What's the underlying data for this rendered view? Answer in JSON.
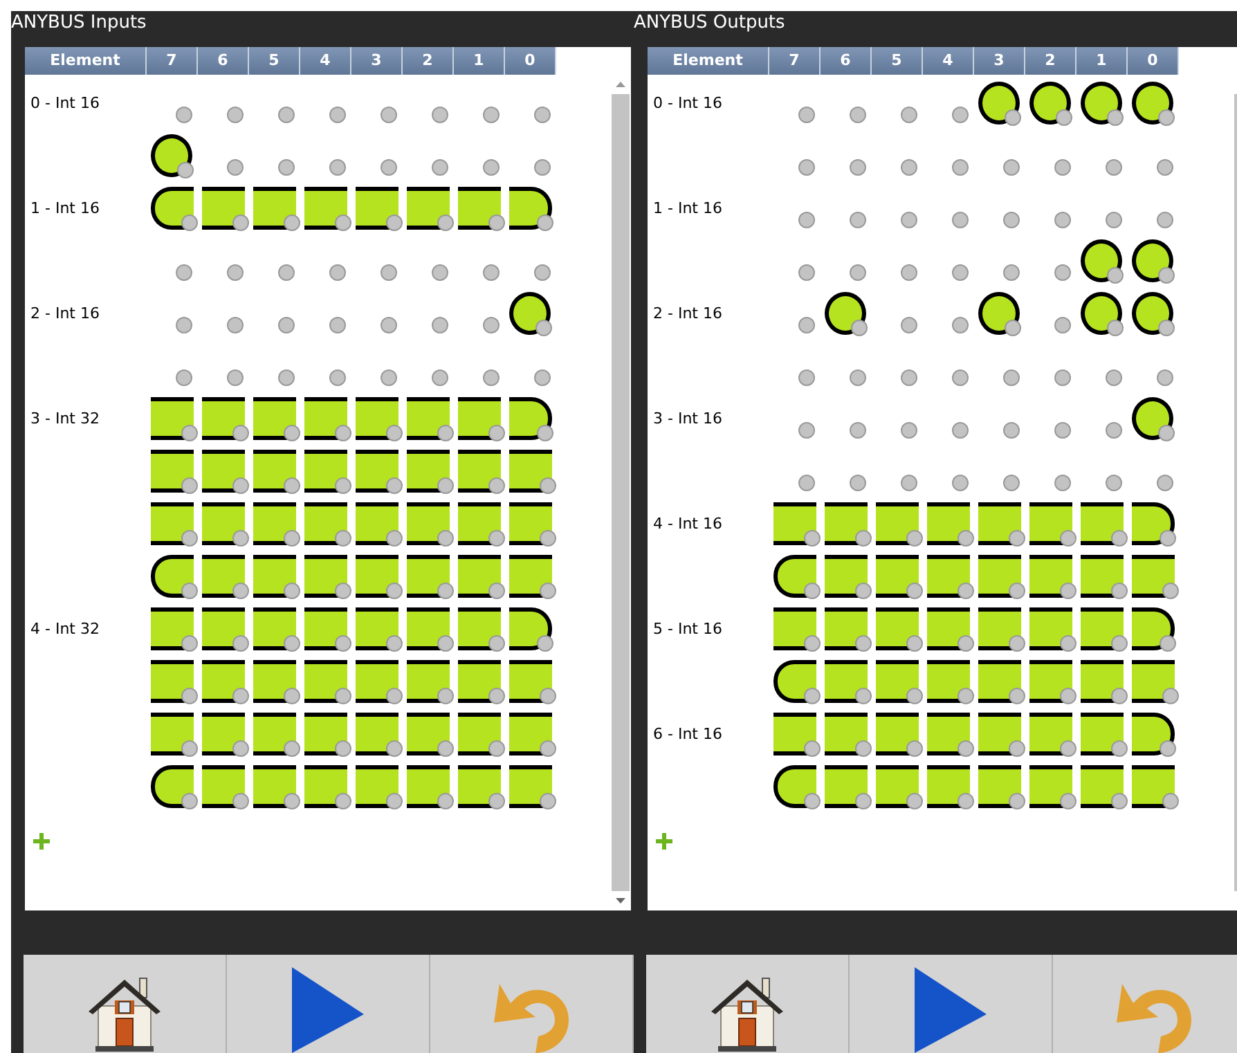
{
  "panels": [
    {
      "title": "ANYBUS Inputs",
      "columns": [
        "Element",
        "7",
        "6",
        "5",
        "4",
        "3",
        "2",
        "1",
        "0"
      ],
      "elements": [
        {
          "label": "0 - Int 16",
          "bytes": [
            [
              {
                "on": false
              },
              {
                "on": false
              },
              {
                "on": false
              },
              {
                "on": false
              },
              {
                "on": false
              },
              {
                "on": false
              },
              {
                "on": false
              },
              {
                "on": false
              }
            ],
            [
              {
                "on": true,
                "round_left": true,
                "round_right": true
              },
              {
                "on": false
              },
              {
                "on": false
              },
              {
                "on": false
              },
              {
                "on": false
              },
              {
                "on": false
              },
              {
                "on": false
              },
              {
                "on": false
              }
            ]
          ]
        },
        {
          "label": "1 - Int 16",
          "bytes": [
            [
              {
                "on": true,
                "round_left": true,
                "round_right": false
              },
              {
                "on": true,
                "round_left": false,
                "round_right": false
              },
              {
                "on": true,
                "round_left": false,
                "round_right": false
              },
              {
                "on": true,
                "round_left": false,
                "round_right": false
              },
              {
                "on": true,
                "round_left": false,
                "round_right": false
              },
              {
                "on": true,
                "round_left": false,
                "round_right": false
              },
              {
                "on": true,
                "round_left": false,
                "round_right": false
              },
              {
                "on": true,
                "round_left": false,
                "round_right": true
              }
            ],
            [
              {
                "on": false
              },
              {
                "on": false
              },
              {
                "on": false
              },
              {
                "on": false
              },
              {
                "on": false
              },
              {
                "on": false
              },
              {
                "on": false
              },
              {
                "on": false
              }
            ]
          ]
        },
        {
          "label": "2 - Int 16",
          "bytes": [
            [
              {
                "on": false
              },
              {
                "on": false
              },
              {
                "on": false
              },
              {
                "on": false
              },
              {
                "on": false
              },
              {
                "on": false
              },
              {
                "on": false
              },
              {
                "on": true,
                "round_left": true,
                "round_right": true
              }
            ],
            [
              {
                "on": false
              },
              {
                "on": false
              },
              {
                "on": false
              },
              {
                "on": false
              },
              {
                "on": false
              },
              {
                "on": false
              },
              {
                "on": false
              },
              {
                "on": false
              }
            ]
          ]
        },
        {
          "label": "3 - Int 32",
          "bytes": [
            [
              {
                "on": true,
                "round_left": false,
                "round_right": false
              },
              {
                "on": true,
                "round_left": false,
                "round_right": false
              },
              {
                "on": true,
                "round_left": false,
                "round_right": false
              },
              {
                "on": true,
                "round_left": false,
                "round_right": false
              },
              {
                "on": true,
                "round_left": false,
                "round_right": false
              },
              {
                "on": true,
                "round_left": false,
                "round_right": false
              },
              {
                "on": true,
                "round_left": false,
                "round_right": false
              },
              {
                "on": true,
                "round_left": false,
                "round_right": true
              }
            ],
            [
              {
                "on": true,
                "round_left": false,
                "round_right": false
              },
              {
                "on": true,
                "round_left": false,
                "round_right": false
              },
              {
                "on": true,
                "round_left": false,
                "round_right": false
              },
              {
                "on": true,
                "round_left": false,
                "round_right": false
              },
              {
                "on": true,
                "round_left": false,
                "round_right": false
              },
              {
                "on": true,
                "round_left": false,
                "round_right": false
              },
              {
                "on": true,
                "round_left": false,
                "round_right": false
              },
              {
                "on": true,
                "round_left": false,
                "round_right": false
              }
            ],
            [
              {
                "on": true,
                "round_left": false,
                "round_right": false
              },
              {
                "on": true,
                "round_left": false,
                "round_right": false
              },
              {
                "on": true,
                "round_left": false,
                "round_right": false
              },
              {
                "on": true,
                "round_left": false,
                "round_right": false
              },
              {
                "on": true,
                "round_left": false,
                "round_right": false
              },
              {
                "on": true,
                "round_left": false,
                "round_right": false
              },
              {
                "on": true,
                "round_left": false,
                "round_right": false
              },
              {
                "on": true,
                "round_left": false,
                "round_right": false
              }
            ],
            [
              {
                "on": true,
                "round_left": true,
                "round_right": false
              },
              {
                "on": true,
                "round_left": false,
                "round_right": false
              },
              {
                "on": true,
                "round_left": false,
                "round_right": false
              },
              {
                "on": true,
                "round_left": false,
                "round_right": false
              },
              {
                "on": true,
                "round_left": false,
                "round_right": false
              },
              {
                "on": true,
                "round_left": false,
                "round_right": false
              },
              {
                "on": true,
                "round_left": false,
                "round_right": false
              },
              {
                "on": true,
                "round_left": false,
                "round_right": false
              }
            ]
          ]
        },
        {
          "label": "4 - Int 32",
          "bytes": [
            [
              {
                "on": true,
                "round_left": false,
                "round_right": false
              },
              {
                "on": true,
                "round_left": false,
                "round_right": false
              },
              {
                "on": true,
                "round_left": false,
                "round_right": false
              },
              {
                "on": true,
                "round_left": false,
                "round_right": false
              },
              {
                "on": true,
                "round_left": false,
                "round_right": false
              },
              {
                "on": true,
                "round_left": false,
                "round_right": false
              },
              {
                "on": true,
                "round_left": false,
                "round_right": false
              },
              {
                "on": true,
                "round_left": false,
                "round_right": true
              }
            ],
            [
              {
                "on": true,
                "round_left": false,
                "round_right": false
              },
              {
                "on": true,
                "round_left": false,
                "round_right": false
              },
              {
                "on": true,
                "round_left": false,
                "round_right": false
              },
              {
                "on": true,
                "round_left": false,
                "round_right": false
              },
              {
                "on": true,
                "round_left": false,
                "round_right": false
              },
              {
                "on": true,
                "round_left": false,
                "round_right": false
              },
              {
                "on": true,
                "round_left": false,
                "round_right": false
              },
              {
                "on": true,
                "round_left": false,
                "round_right": false
              }
            ],
            [
              {
                "on": true,
                "round_left": false,
                "round_right": false
              },
              {
                "on": true,
                "round_left": false,
                "round_right": false
              },
              {
                "on": true,
                "round_left": false,
                "round_right": false
              },
              {
                "on": true,
                "round_left": false,
                "round_right": false
              },
              {
                "on": true,
                "round_left": false,
                "round_right": false
              },
              {
                "on": true,
                "round_left": false,
                "round_right": false
              },
              {
                "on": true,
                "round_left": false,
                "round_right": false
              },
              {
                "on": true,
                "round_left": false,
                "round_right": false
              }
            ],
            [
              {
                "on": true,
                "round_left": true,
                "round_right": false
              },
              {
                "on": true,
                "round_left": false,
                "round_right": false
              },
              {
                "on": true,
                "round_left": false,
                "round_right": false
              },
              {
                "on": true,
                "round_left": false,
                "round_right": false
              },
              {
                "on": true,
                "round_left": false,
                "round_right": false
              },
              {
                "on": true,
                "round_left": false,
                "round_right": false
              },
              {
                "on": true,
                "round_left": false,
                "round_right": false
              },
              {
                "on": true,
                "round_left": false,
                "round_right": false
              }
            ]
          ]
        }
      ]
    },
    {
      "title": "ANYBUS Outputs",
      "columns": [
        "Element",
        "7",
        "6",
        "5",
        "4",
        "3",
        "2",
        "1",
        "0"
      ],
      "elements": [
        {
          "label": "0 - Int 16",
          "bytes": [
            [
              {
                "on": false
              },
              {
                "on": false
              },
              {
                "on": false
              },
              {
                "on": false
              },
              {
                "on": true,
                "round_left": true,
                "round_right": true
              },
              {
                "on": true,
                "round_left": true,
                "round_right": true
              },
              {
                "on": true,
                "round_left": true,
                "round_right": true
              },
              {
                "on": true,
                "round_left": true,
                "round_right": true
              }
            ],
            [
              {
                "on": false
              },
              {
                "on": false
              },
              {
                "on": false
              },
              {
                "on": false
              },
              {
                "on": false
              },
              {
                "on": false
              },
              {
                "on": false
              },
              {
                "on": false
              }
            ]
          ]
        },
        {
          "label": "1 - Int 16",
          "bytes": [
            [
              {
                "on": false
              },
              {
                "on": false
              },
              {
                "on": false
              },
              {
                "on": false
              },
              {
                "on": false
              },
              {
                "on": false
              },
              {
                "on": false
              },
              {
                "on": false
              }
            ],
            [
              {
                "on": false
              },
              {
                "on": false
              },
              {
                "on": false
              },
              {
                "on": false
              },
              {
                "on": false
              },
              {
                "on": false
              },
              {
                "on": true,
                "round_left": true,
                "round_right": true
              },
              {
                "on": true,
                "round_left": true,
                "round_right": true
              }
            ]
          ]
        },
        {
          "label": "2 - Int 16",
          "bytes": [
            [
              {
                "on": false
              },
              {
                "on": true,
                "round_left": true,
                "round_right": true
              },
              {
                "on": false
              },
              {
                "on": false
              },
              {
                "on": true,
                "round_left": true,
                "round_right": true
              },
              {
                "on": false
              },
              {
                "on": true,
                "round_left": true,
                "round_right": true
              },
              {
                "on": true,
                "round_left": true,
                "round_right": true
              }
            ],
            [
              {
                "on": false
              },
              {
                "on": false
              },
              {
                "on": false
              },
              {
                "on": false
              },
              {
                "on": false
              },
              {
                "on": false
              },
              {
                "on": false
              },
              {
                "on": false
              }
            ]
          ]
        },
        {
          "label": "3 - Int 16",
          "bytes": [
            [
              {
                "on": false
              },
              {
                "on": false
              },
              {
                "on": false
              },
              {
                "on": false
              },
              {
                "on": false
              },
              {
                "on": false
              },
              {
                "on": false
              },
              {
                "on": true,
                "round_left": true,
                "round_right": true
              }
            ],
            [
              {
                "on": false
              },
              {
                "on": false
              },
              {
                "on": false
              },
              {
                "on": false
              },
              {
                "on": false
              },
              {
                "on": false
              },
              {
                "on": false
              },
              {
                "on": false
              }
            ]
          ]
        },
        {
          "label": "4 - Int 16",
          "bytes": [
            [
              {
                "on": true,
                "round_left": false,
                "round_right": false
              },
              {
                "on": true,
                "round_left": false,
                "round_right": false
              },
              {
                "on": true,
                "round_left": false,
                "round_right": false
              },
              {
                "on": true,
                "round_left": false,
                "round_right": false
              },
              {
                "on": true,
                "round_left": false,
                "round_right": false
              },
              {
                "on": true,
                "round_left": false,
                "round_right": false
              },
              {
                "on": true,
                "round_left": false,
                "round_right": false
              },
              {
                "on": true,
                "round_left": false,
                "round_right": true
              }
            ],
            [
              {
                "on": true,
                "round_left": true,
                "round_right": false
              },
              {
                "on": true,
                "round_left": false,
                "round_right": false
              },
              {
                "on": true,
                "round_left": false,
                "round_right": false
              },
              {
                "on": true,
                "round_left": false,
                "round_right": false
              },
              {
                "on": true,
                "round_left": false,
                "round_right": false
              },
              {
                "on": true,
                "round_left": false,
                "round_right": false
              },
              {
                "on": true,
                "round_left": false,
                "round_right": false
              },
              {
                "on": true,
                "round_left": false,
                "round_right": false
              }
            ]
          ]
        },
        {
          "label": "5 - Int 16",
          "bytes": [
            [
              {
                "on": true,
                "round_left": false,
                "round_right": false
              },
              {
                "on": true,
                "round_left": false,
                "round_right": false
              },
              {
                "on": true,
                "round_left": false,
                "round_right": false
              },
              {
                "on": true,
                "round_left": false,
                "round_right": false
              },
              {
                "on": true,
                "round_left": false,
                "round_right": false
              },
              {
                "on": true,
                "round_left": false,
                "round_right": false
              },
              {
                "on": true,
                "round_left": false,
                "round_right": false
              },
              {
                "on": true,
                "round_left": false,
                "round_right": true
              }
            ],
            [
              {
                "on": true,
                "round_left": true,
                "round_right": false
              },
              {
                "on": true,
                "round_left": false,
                "round_right": false
              },
              {
                "on": true,
                "round_left": false,
                "round_right": false
              },
              {
                "on": true,
                "round_left": false,
                "round_right": false
              },
              {
                "on": true,
                "round_left": false,
                "round_right": false
              },
              {
                "on": true,
                "round_left": false,
                "round_right": false
              },
              {
                "on": true,
                "round_left": false,
                "round_right": false
              },
              {
                "on": true,
                "round_left": false,
                "round_right": false
              }
            ]
          ]
        },
        {
          "label": "6 - Int 16",
          "bytes": [
            [
              {
                "on": true,
                "round_left": false,
                "round_right": false
              },
              {
                "on": true,
                "round_left": false,
                "round_right": false
              },
              {
                "on": true,
                "round_left": false,
                "round_right": false
              },
              {
                "on": true,
                "round_left": false,
                "round_right": false
              },
              {
                "on": true,
                "round_left": false,
                "round_right": false
              },
              {
                "on": true,
                "round_left": false,
                "round_right": false
              },
              {
                "on": true,
                "round_left": false,
                "round_right": false
              },
              {
                "on": true,
                "round_left": false,
                "round_right": true
              }
            ],
            [
              {
                "on": true,
                "round_left": true,
                "round_right": false
              },
              {
                "on": true,
                "round_left": false,
                "round_right": false
              },
              {
                "on": true,
                "round_left": false,
                "round_right": false
              },
              {
                "on": true,
                "round_left": false,
                "round_right": false
              },
              {
                "on": true,
                "round_left": false,
                "round_right": false
              },
              {
                "on": true,
                "round_left": false,
                "round_right": false
              },
              {
                "on": true,
                "round_left": false,
                "round_right": false
              },
              {
                "on": true,
                "round_left": false,
                "round_right": false
              }
            ]
          ]
        }
      ]
    }
  ]
}
